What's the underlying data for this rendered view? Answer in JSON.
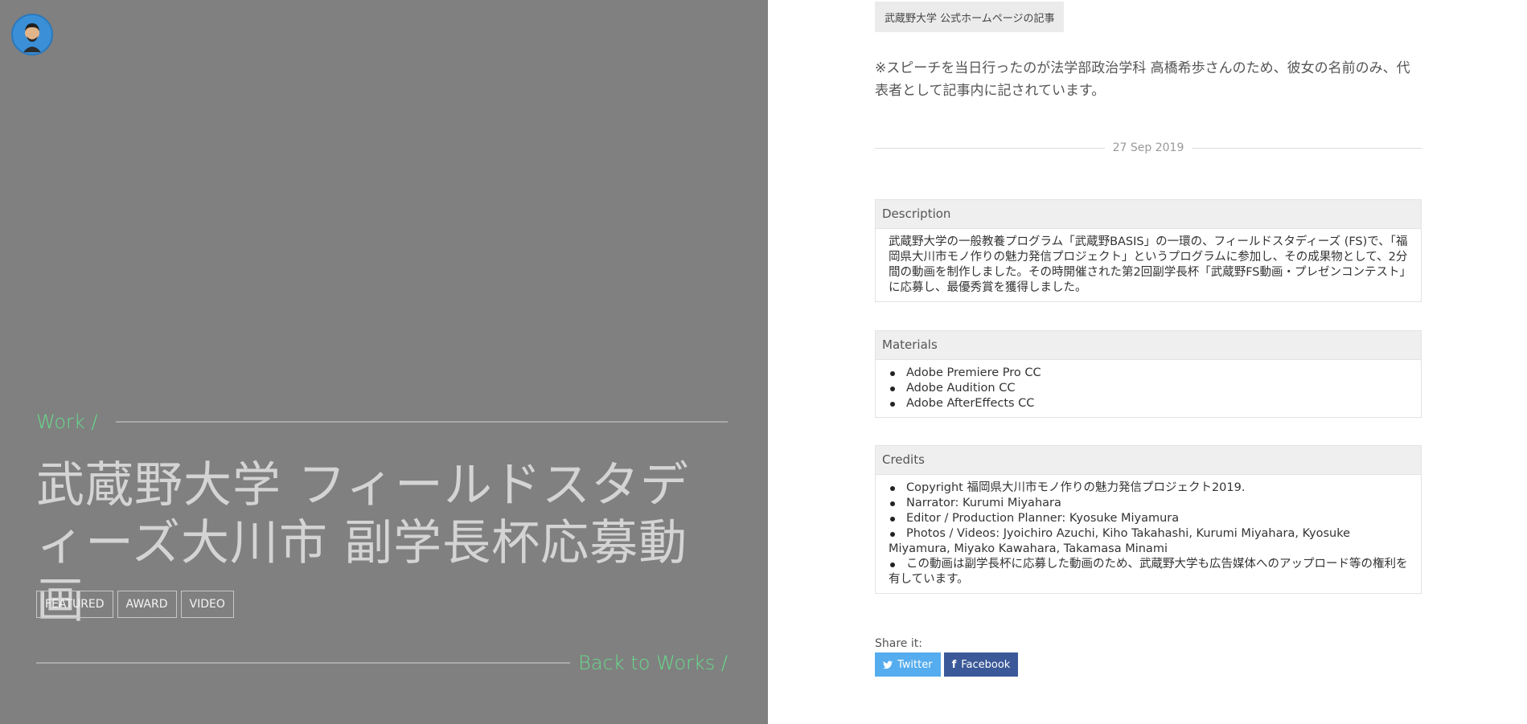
{
  "hero": {
    "section_label": "Work /",
    "title": "武蔵野大学 フィールドスタディーズ大川市 副学長杯応募動画",
    "tags": [
      "FEATURED",
      "AWARD",
      "VIDEO"
    ],
    "back_link": "Back to Works /"
  },
  "article": {
    "source_badge": "武蔵野大学 公式ホームページの記事",
    "note": "※スピーチを当日行ったのが法学部政治学科 高橋希歩さんのため、彼女の名前のみ、代表者として記事内に記されています。",
    "date": "27 Sep 2019"
  },
  "description": {
    "heading": "Description",
    "text": "武蔵野大学の一般教養プログラム「武蔵野BASIS」の一環の、フィールドスタディーズ (FS)で、「福岡県大川市モノ作りの魅力発信プロジェクト」というプログラムに参加し、その成果物として、2分間の動画を制作しました。その時開催された第2回副学長杯「武蔵野FS動画・プレゼンコンテスト」に応募し、最優秀賞を獲得しました。"
  },
  "materials": {
    "heading": "Materials",
    "items": [
      "Adobe Premiere Pro CC",
      "Adobe Audition CC",
      "Adobe AfterEffects CC"
    ]
  },
  "credits": {
    "heading": "Credits",
    "items": [
      "Copyright 福岡県大川市モノ作りの魅力発信プロジェクト2019.",
      "Narrator: Kurumi Miyahara",
      "Editor / Production Planner: Kyosuke Miyamura",
      "Photos / Videos: Jyoichiro Azuchi, Kiho Takahashi, Kurumi Miyahara, Kyosuke Miyamura, Miyako Kawahara, Takamasa Minami",
      "この動画は副学長杯に応募した動画のため、武蔵野大学も広告媒体へのアップロード等の権利を有しています。"
    ]
  },
  "share": {
    "label": "Share it:",
    "twitter": "Twitter",
    "facebook": "Facebook",
    "twitter_color": "#55acee",
    "facebook_color": "#3b5998"
  },
  "colors": {
    "hero_bg": "#808080",
    "accent_green": "#67d98a"
  },
  "icons": {
    "twitter": "twitter-bird-icon",
    "facebook": "facebook-f-icon"
  }
}
